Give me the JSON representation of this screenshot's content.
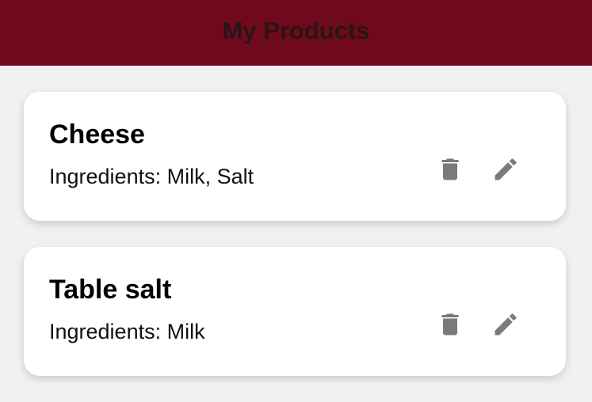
{
  "header": {
    "title": "My Products",
    "background": "#6e0a1b"
  },
  "products": [
    {
      "name": "Cheese",
      "ingredients": "Ingredients: Milk, Salt",
      "delete_icon": "trash-icon",
      "edit_icon": "pencil-icon"
    },
    {
      "name": "Table salt",
      "ingredients": "Ingredients: Milk",
      "delete_icon": "trash-icon",
      "edit_icon": "pencil-icon"
    }
  ],
  "colors": {
    "page_background": "#f1f1f1",
    "card_background": "#ffffff",
    "icon": "#7a7a7a"
  }
}
